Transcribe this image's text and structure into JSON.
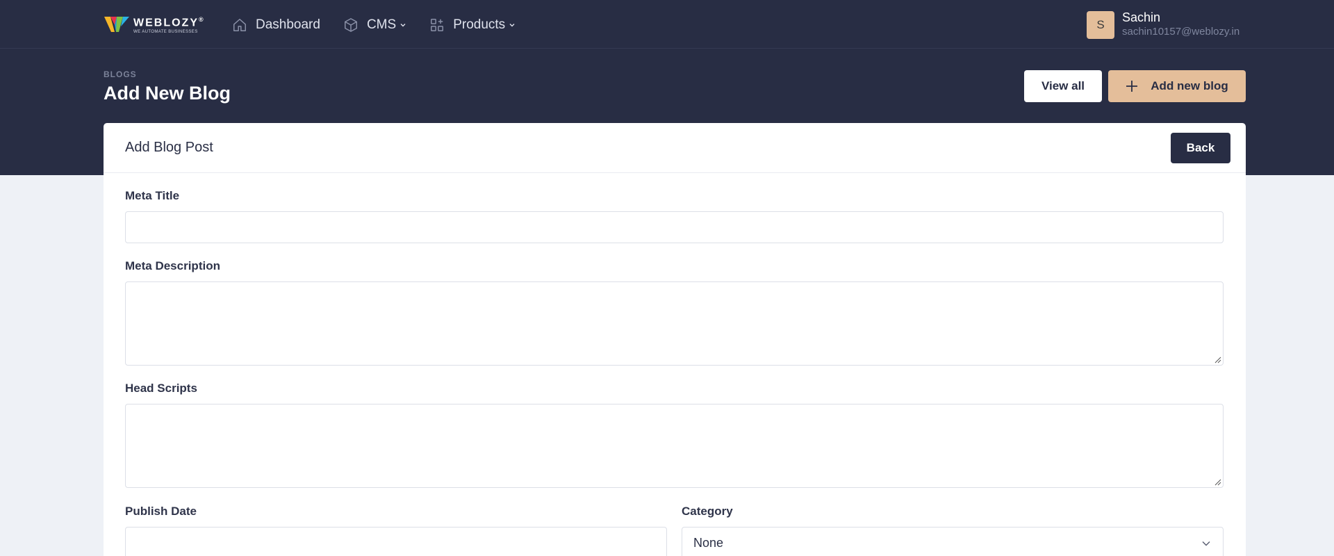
{
  "brand": {
    "name": "WEBLOZY",
    "registered": "®",
    "tagline": "WE AUTOMATE BUSINESSES"
  },
  "nav": {
    "items": [
      {
        "label": "Dashboard",
        "icon": "home-icon",
        "has_dropdown": false
      },
      {
        "label": "CMS",
        "icon": "cube-icon",
        "has_dropdown": true
      },
      {
        "label": "Products",
        "icon": "grid-plus-icon",
        "has_dropdown": true
      }
    ]
  },
  "user": {
    "initial": "S",
    "name": "Sachin",
    "email": "sachin10157@weblozy.in"
  },
  "page": {
    "breadcrumb": "BLOGS",
    "title": "Add New Blog"
  },
  "actions": {
    "view_all": "View all",
    "add_new": "Add new blog"
  },
  "card": {
    "title": "Add Blog Post",
    "back": "Back"
  },
  "form": {
    "meta_title": {
      "label": "Meta Title",
      "value": ""
    },
    "meta_description": {
      "label": "Meta Description",
      "value": ""
    },
    "head_scripts": {
      "label": "Head Scripts",
      "value": ""
    },
    "publish_date": {
      "label": "Publish Date",
      "value": ""
    },
    "category": {
      "label": "Category",
      "selected": "None"
    }
  },
  "colors": {
    "header_bg": "#282d44",
    "accent": "#e4be9a",
    "page_bg": "#eef1f6"
  }
}
